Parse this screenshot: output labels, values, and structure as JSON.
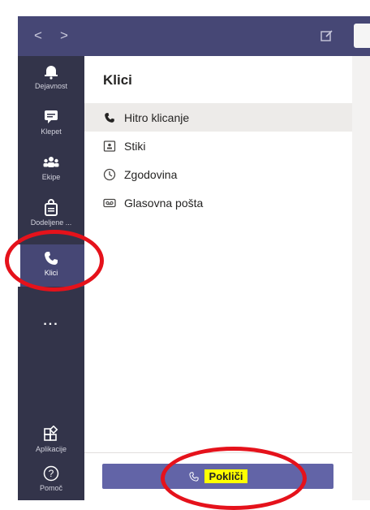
{
  "topbar": {
    "back_icon": "chevron-left-icon",
    "forward_icon": "chevron-right-icon",
    "compose_icon": "compose-icon",
    "back_glyph": "<",
    "forward_glyph": ">"
  },
  "rail": {
    "items": [
      {
        "label": "Dejavnost",
        "icon": "bell-icon"
      },
      {
        "label": "Klepet",
        "icon": "chat-icon"
      },
      {
        "label": "Ekipe",
        "icon": "teams-icon"
      },
      {
        "label": "Dodeljene ...",
        "icon": "assignments-icon"
      },
      {
        "label": "Klici",
        "icon": "phone-icon",
        "active": true
      },
      {
        "label": "Aplikacije",
        "icon": "apps-icon"
      },
      {
        "label": "Pomoč",
        "icon": "help-icon"
      }
    ],
    "more": "..."
  },
  "panel": {
    "title": "Klici",
    "items": [
      {
        "label": "Hitro klicanje",
        "icon": "phone-icon",
        "selected": true
      },
      {
        "label": "Stiki",
        "icon": "contact-card-icon"
      },
      {
        "label": "Zgodovina",
        "icon": "clock-icon"
      },
      {
        "label": "Glasovna pošta",
        "icon": "voicemail-icon"
      }
    ],
    "call_button": {
      "label": "Pokliči",
      "icon": "phone-icon"
    }
  },
  "colors": {
    "rail_bg": "#33344a",
    "topbar_bg": "#464775",
    "accent": "#6264a7",
    "highlight": "#ffff00",
    "annotation": "#e5121b"
  }
}
